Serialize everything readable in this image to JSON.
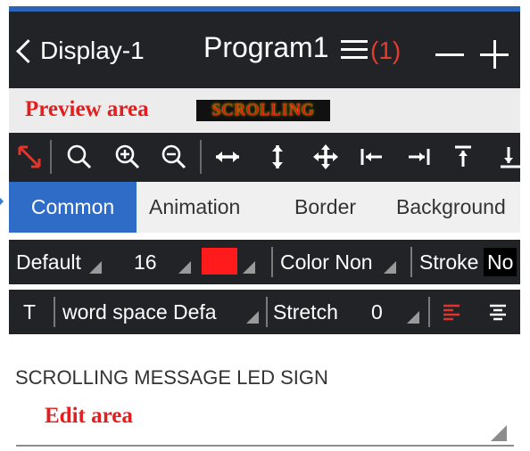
{
  "header": {
    "back_label": "Display-1",
    "program_title": "Program1",
    "badge_count": "(1)",
    "icons": [
      "back-chevron-icon",
      "menu-icon",
      "minus-icon",
      "plus-icon"
    ]
  },
  "preview": {
    "label": "Preview area",
    "scroll_text": "SCROLLING"
  },
  "toolbar": {
    "icons": [
      "resize-arrows-icon",
      "zoom-icon",
      "zoom-in-icon",
      "zoom-out-icon",
      "horizontal-resize-icon",
      "vertical-resize-icon",
      "move-icon",
      "align-left-icon",
      "align-right-icon",
      "align-top-icon",
      "align-bottom-icon"
    ]
  },
  "tabs": [
    {
      "label": "Common",
      "active": true
    },
    {
      "label": "Animation",
      "active": false
    },
    {
      "label": "Border",
      "active": false
    },
    {
      "label": "Background",
      "active": false
    }
  ],
  "font_row": {
    "font": "Default",
    "size": "16",
    "color_swatch": "#ff1b1b",
    "color_label": "Color Non",
    "stroke_label": "Stroke",
    "stroke_value": "No"
  },
  "text_row": {
    "t_label": "T",
    "word_space": "word space Defa",
    "stretch_label": "Stretch",
    "stretch_value": "0",
    "icons": [
      "align-text-left-icon",
      "align-text-center-icon"
    ]
  },
  "edit": {
    "content": "SCROLLING MESSAGE LED SIGN",
    "label": "Edit area"
  },
  "colors": {
    "header_bg": "#222326",
    "accent_blue": "#2f6cc7",
    "annotation_red": "#e41e1e",
    "badge_red": "#e43b2f",
    "active_icon_red": "#e2342a"
  }
}
